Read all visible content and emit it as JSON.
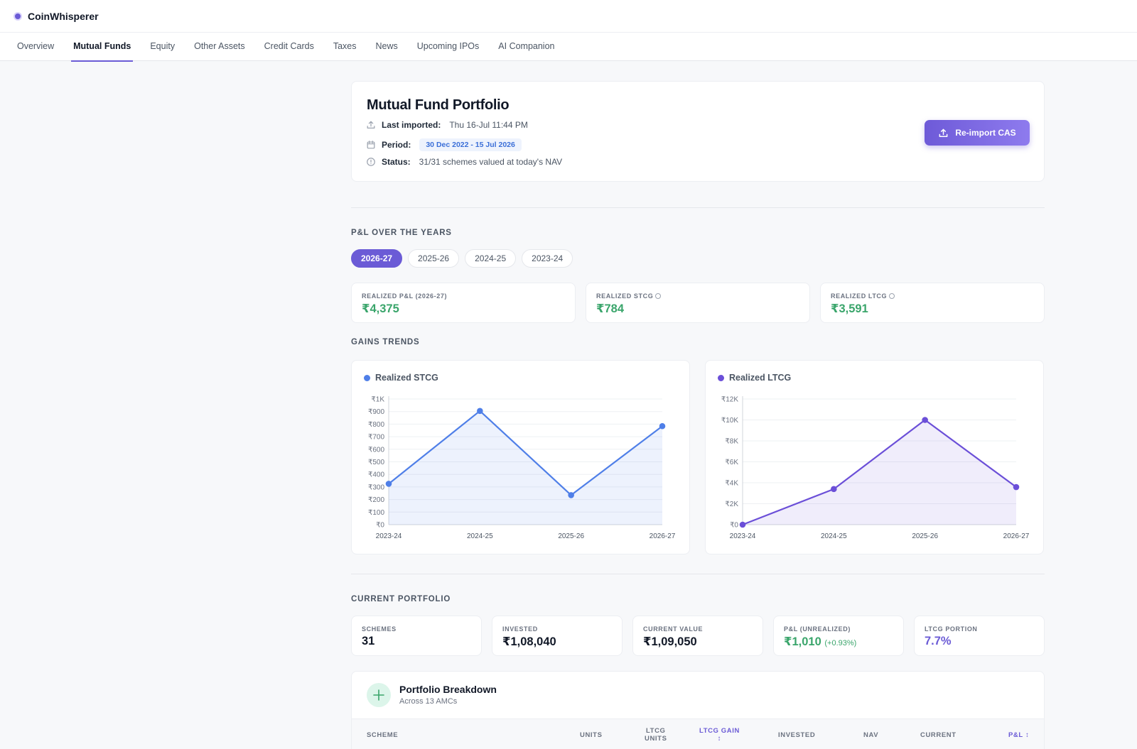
{
  "app": {
    "name": "CoinWhisperer"
  },
  "nav": {
    "tabs": [
      {
        "label": "Overview"
      },
      {
        "label": "Mutual Funds",
        "active": true
      },
      {
        "label": "Equity"
      },
      {
        "label": "Other Assets"
      },
      {
        "label": "Credit Cards"
      },
      {
        "label": "Taxes"
      },
      {
        "label": "News"
      },
      {
        "label": "Upcoming IPOs"
      },
      {
        "label": "AI Companion"
      }
    ]
  },
  "header": {
    "title": "Mutual Fund Portfolio",
    "last_imported_label": "Last imported:",
    "last_imported_value": "Thu 16-Jul 11:44 PM",
    "period_label": "Period:",
    "period_value": "30 Dec 2022 - 15 Jul 2026",
    "status_label": "Status:",
    "status_value": "31/31 schemes valued at today's NAV",
    "reimport_button": "Re-import CAS"
  },
  "pnl_section": {
    "title": "P&L OVER THE YEARS",
    "years": [
      "2026-27",
      "2025-26",
      "2024-25",
      "2023-24"
    ],
    "selected_year": "2026-27",
    "stats": [
      {
        "label": "REALIZED P&L (2026-27)",
        "value": "₹4,375",
        "info": false
      },
      {
        "label": "REALIZED STCG",
        "value": "₹784",
        "info": true
      },
      {
        "label": "REALIZED LTCG",
        "value": "₹3,591",
        "info": true
      }
    ]
  },
  "gains_section": {
    "title": "GAINS TRENDS"
  },
  "chart_data": [
    {
      "type": "area",
      "series_name": "Realized STCG",
      "color": "#4f7fe8",
      "categories": [
        "2023-24",
        "2024-25",
        "2025-26",
        "2026-27"
      ],
      "values": [
        325,
        905,
        235,
        784
      ],
      "ylim": [
        0,
        1000
      ],
      "yticks": [
        0,
        100,
        200,
        300,
        400,
        500,
        600,
        700,
        800,
        900,
        1000
      ],
      "ytick_labels": [
        "₹0",
        "₹100",
        "₹200",
        "₹300",
        "₹400",
        "₹500",
        "₹600",
        "₹700",
        "₹800",
        "₹900",
        "₹1K"
      ],
      "grid": true
    },
    {
      "type": "area",
      "series_name": "Realized LTCG",
      "color": "#6b4fd8",
      "categories": [
        "2023-24",
        "2024-25",
        "2025-26",
        "2026-27"
      ],
      "values": [
        0,
        3400,
        10000,
        3591
      ],
      "ylim": [
        0,
        12000
      ],
      "yticks": [
        0,
        2000,
        4000,
        6000,
        8000,
        10000,
        12000
      ],
      "ytick_labels": [
        "₹0",
        "₹2K",
        "₹4K",
        "₹6K",
        "₹8K",
        "₹10K",
        "₹12K"
      ],
      "grid": true
    }
  ],
  "portfolio_section": {
    "title": "CURRENT PORTFOLIO",
    "cards": [
      {
        "label": "SCHEMES",
        "value": "31",
        "sub": "",
        "tone": ""
      },
      {
        "label": "INVESTED",
        "value": "₹1,08,040",
        "sub": "",
        "tone": ""
      },
      {
        "label": "CURRENT VALUE",
        "value": "₹1,09,050",
        "sub": "",
        "tone": ""
      },
      {
        "label": "P&L (UNREALIZED)",
        "value": "₹1,010",
        "sub": "(+0.93%)",
        "tone": "green"
      },
      {
        "label": "LTCG PORTION",
        "value": "7.7%",
        "sub": "",
        "tone": "purple"
      }
    ]
  },
  "breakdown": {
    "title": "Portfolio Breakdown",
    "subtitle": "Across 13 AMCs",
    "columns": {
      "scheme": "SCHEME",
      "units": "UNITS",
      "ltcg_units_1": "LTCG",
      "ltcg_units_2": "UNITS",
      "ltcg_gain": "LTCG GAIN",
      "invested": "INVESTED",
      "nav": "NAV",
      "current": "CURRENT",
      "pnl": "P&L"
    },
    "sort_glyph": "↕"
  }
}
